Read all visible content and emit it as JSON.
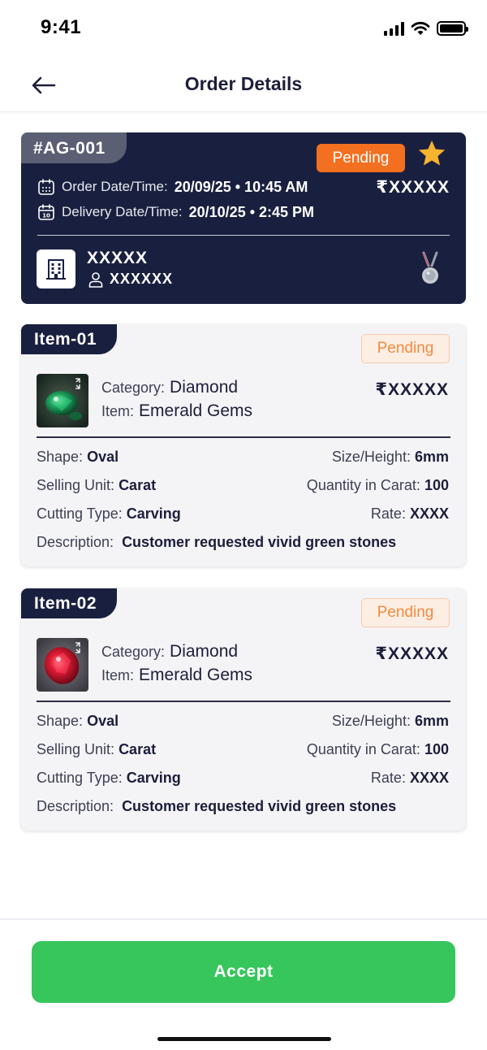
{
  "status_bar": {
    "time": "9:41"
  },
  "header": {
    "title": "Order Details",
    "back_icon": "arrow-left-icon"
  },
  "order": {
    "id": "#AG-001",
    "status": "Pending",
    "price": "₹XXXXX",
    "order_date_label": "Order Date/Time:",
    "order_date_value": "20/09/25 • 10:45 AM",
    "delivery_date_label": "Delivery Date/Time:",
    "delivery_date_value": "20/10/25 • 2:45 PM",
    "company": "XXXXX",
    "contact": "XXXXXX",
    "accent_color": "#f37021",
    "card_color": "#19203f"
  },
  "items": [
    {
      "tag": "Item-01",
      "status": "Pending",
      "category_label": "Category:",
      "category": "Diamond",
      "item_label": "Item:",
      "item": "Emerald Gems",
      "price": "₹XXXXX",
      "shape_label": "Shape:",
      "shape": "Oval",
      "size_label": "Size/Height:",
      "size": "6mm",
      "unit_label": "Selling Unit:",
      "unit": "Carat",
      "qty_label": "Quantity in Carat:",
      "qty": "100",
      "cut_label": "Cutting Type:",
      "cut": "Carving",
      "rate_label": "Rate:",
      "rate": "XXXX",
      "desc_label": "Description:",
      "desc": "Customer requested vivid green stones",
      "gem_color": "green"
    },
    {
      "tag": "Item-02",
      "status": "Pending",
      "category_label": "Category:",
      "category": "Diamond",
      "item_label": "Item:",
      "item": "Emerald Gems",
      "price": "₹XXXXX",
      "shape_label": "Shape:",
      "shape": "Oval",
      "size_label": "Size/Height:",
      "size": "6mm",
      "unit_label": "Selling Unit:",
      "unit": "Carat",
      "qty_label": "Quantity in Carat:",
      "qty": "100",
      "cut_label": "Cutting Type:",
      "cut": "Carving",
      "rate_label": "Rate:",
      "rate": "XXXX",
      "desc_label": "Description:",
      "desc": "Customer requested vivid green stones",
      "gem_color": "red"
    }
  ],
  "footer": {
    "accept_label": "Accept",
    "accept_color": "#36c65c"
  }
}
